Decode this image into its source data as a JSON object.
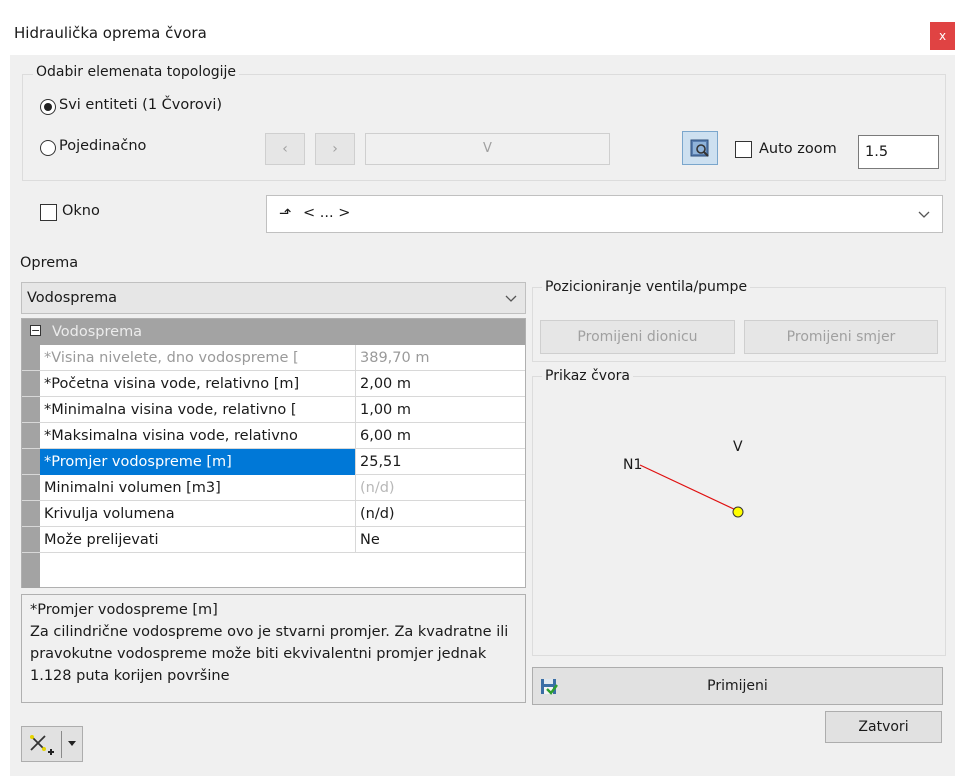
{
  "window": {
    "title": "Hidraulička oprema čvora",
    "close": "x"
  },
  "topology": {
    "group_label": "Odabir elemenata topologije",
    "all_label": "Svi entiteti (1 Čvorovi)",
    "single_label": "Pojedinačno",
    "nav_prev": "‹",
    "nav_next": "›",
    "node_value": "V",
    "auto_zoom_label": "Auto zoom",
    "auto_zoom_value": "1.5"
  },
  "okno": {
    "label": "Okno",
    "combo_value": "< ... >"
  },
  "oprema": {
    "label": "Oprema",
    "selected": "Vodosprema",
    "category": "Vodosprema",
    "rows": [
      {
        "name": "*Visina nivelete, dno vodospreme [",
        "value": "389,70 m",
        "state": "disabled"
      },
      {
        "name": "*Početna visina vode, relativno [m]",
        "value": "2,00 m",
        "state": "normal"
      },
      {
        "name": "*Minimalna visina vode, relativno [",
        "value": "1,00 m",
        "state": "normal"
      },
      {
        "name": "*Maksimalna visina vode, relativno",
        "value": "6,00 m",
        "state": "normal"
      },
      {
        "name": "*Promjer vodospreme [m]",
        "value": "25,51",
        "state": "selected"
      },
      {
        "name": "Minimalni volumen [m3]",
        "value": "(n/d)",
        "state": "valuedisabled"
      },
      {
        "name": "Krivulja volumena",
        "value": "(n/d)",
        "state": "normal"
      },
      {
        "name": "Može prelijevati",
        "value": "Ne",
        "state": "normal"
      }
    ],
    "description_title": "*Promjer vodospreme [m]",
    "description_text": "Za cilindrične vodospreme ovo je stvarni promjer. Za kvadratne ili pravokutne vodospreme može biti ekvivalentni promjer jednak 1.128 puta korijen površine"
  },
  "positioning": {
    "label": "Pozicioniranje ventila/pumpe",
    "change_section": "Promijeni dionicu",
    "change_direction": "Promijeni smjer"
  },
  "preview": {
    "label": "Prikaz čvora",
    "node_v": "V",
    "node_n1": "N1",
    "line_color": "#e01010",
    "node_color": "#ffff00"
  },
  "actions": {
    "apply": "Primijeni",
    "close": "Zatvori"
  },
  "colors": {
    "selection": "#0078d7",
    "close_red": "#e04343"
  }
}
